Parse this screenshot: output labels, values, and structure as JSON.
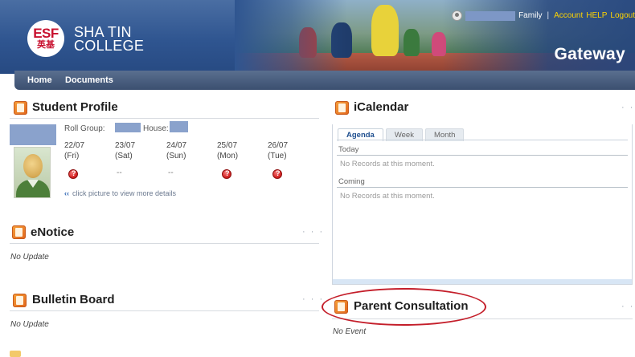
{
  "header": {
    "logo": {
      "esf": "ESF",
      "chinese": "英基"
    },
    "school_name": [
      "SHA TIN",
      "COLLEGE"
    ],
    "user_role": "Family",
    "links": [
      "Account",
      "HELP",
      "Logout"
    ],
    "portal_name": "Gateway"
  },
  "nav": {
    "items": [
      "Home",
      "Documents"
    ]
  },
  "student_profile": {
    "title": "Student Profile",
    "roll_group_label": "Roll Group:",
    "house_label": "House:",
    "dates": [
      {
        "date": "22/07",
        "day": "(Fri)",
        "status": "unknown"
      },
      {
        "date": "23/07",
        "day": "(Sat)",
        "status": "--"
      },
      {
        "date": "24/07",
        "day": "(Sun)",
        "status": "--"
      },
      {
        "date": "25/07",
        "day": "(Mon)",
        "status": "unknown"
      },
      {
        "date": "26/07",
        "day": "(Tue)",
        "status": "unknown"
      }
    ],
    "hint": "click picture to view more details",
    "hint_chevron": "‹‹"
  },
  "enotice": {
    "title": "eNotice",
    "status": "No Update",
    "more": "· · ·"
  },
  "bulletin_board": {
    "title": "Bulletin Board",
    "status": "No Update",
    "more": "· · ·"
  },
  "icalendar": {
    "title": "iCalendar",
    "more": "· ·",
    "tabs": [
      "Agenda",
      "Week",
      "Month"
    ],
    "active_tab": "Agenda",
    "sections": [
      {
        "label": "Today",
        "empty_text": "No Records at this moment."
      },
      {
        "label": "Coming",
        "empty_text": "No Records at this moment."
      }
    ]
  },
  "parent_consultation": {
    "title": "Parent Consultation",
    "status": "No Event",
    "more": "· ·"
  },
  "colors": {
    "header_blue": "#2f5590",
    "nav_bar": "#3b4f70",
    "link_yellow": "#ffd400",
    "brand_red": "#c8102e",
    "section_icon_orange": "#e1651b",
    "highlight_red": "#c41e2a",
    "redaction_blue": "#8aa2cc"
  },
  "icons": {
    "student_profile": "id-card-icon",
    "enotice": "notice-icon",
    "bulletin_board": "bulletin-icon",
    "icalendar": "calendar-icon",
    "parent_consultation": "consultation-icon",
    "attendance_unknown": "question-mark-icon",
    "user": "user-avatar-icon"
  }
}
